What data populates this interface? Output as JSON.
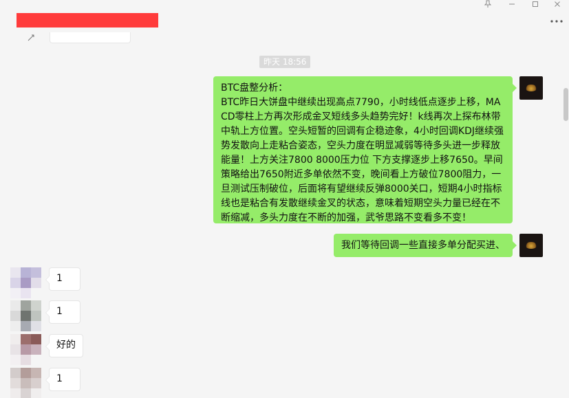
{
  "window": {
    "pin_icon": "pin-icon",
    "minimize_icon": "minimize-icon",
    "maximize_icon": "maximize-icon",
    "close_icon": "close-icon",
    "more_icon": "more-icon",
    "title_redacted_color": "#ff3b3b"
  },
  "chat": {
    "timestamp": "昨天 18:56",
    "outgoing": [
      {
        "text": "BTC盘整分析：\nBTC昨日大饼盘中继续出现高点7790，小时线低点逐步上移，MACD零柱上方再次形成金叉短线多头趋势完好！k线再次上探布林带中轨上方位置。空头短暂的回调有企稳迹象，4小时回调KDJ继续强势发散向上走粘合姿态，空头力度在明显减弱等待多头进一步释放能量！上方关注7800 8000压力位 下方支撑逐步上移7650。早间策略给出7650附近多单依然不变，晚间看上方破位7800阻力，一旦测试压制破位，后面将有望继续反弹8000关口，短期4小时指标线也是粘合有发散继续金叉的状态，意味着短期空头力量已经在不断缩减，多头力度在不断的加强，武爷思路不变看多不变！"
      },
      {
        "text": "我们等待回调一些直接多单分配买进、"
      }
    ],
    "incoming": [
      {
        "text": "1"
      },
      {
        "text": "1"
      },
      {
        "text": "好的"
      },
      {
        "text": "1"
      }
    ]
  },
  "colors": {
    "outgoing_bubble": "#95ec69",
    "incoming_bubble": "#ffffff",
    "background": "#f5f5f5"
  }
}
